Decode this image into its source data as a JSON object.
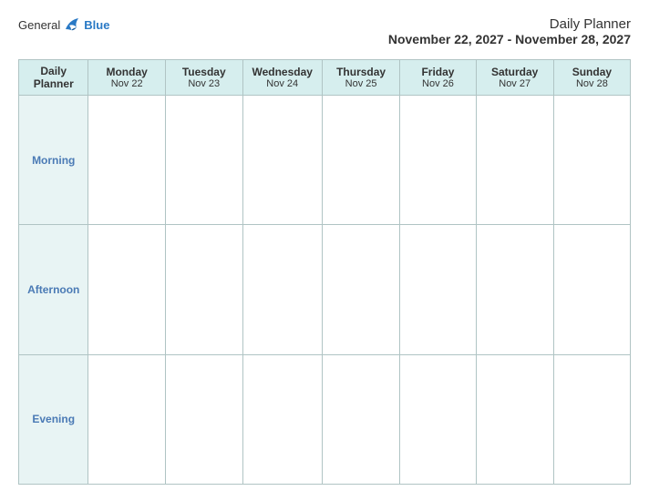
{
  "header": {
    "logo_general": "General",
    "logo_blue": "Blue",
    "title": "Daily Planner",
    "date_range": "November 22, 2027 - November 28, 2027"
  },
  "table": {
    "label_column": "Daily Planner",
    "days": [
      {
        "name": "Monday",
        "date": "Nov 22"
      },
      {
        "name": "Tuesday",
        "date": "Nov 23"
      },
      {
        "name": "Wednesday",
        "date": "Nov 24"
      },
      {
        "name": "Thursday",
        "date": "Nov 25"
      },
      {
        "name": "Friday",
        "date": "Nov 26"
      },
      {
        "name": "Saturday",
        "date": "Nov 27"
      },
      {
        "name": "Sunday",
        "date": "Nov 28"
      }
    ],
    "rows": [
      {
        "label": "Morning"
      },
      {
        "label": "Afternoon"
      },
      {
        "label": "Evening"
      }
    ]
  }
}
